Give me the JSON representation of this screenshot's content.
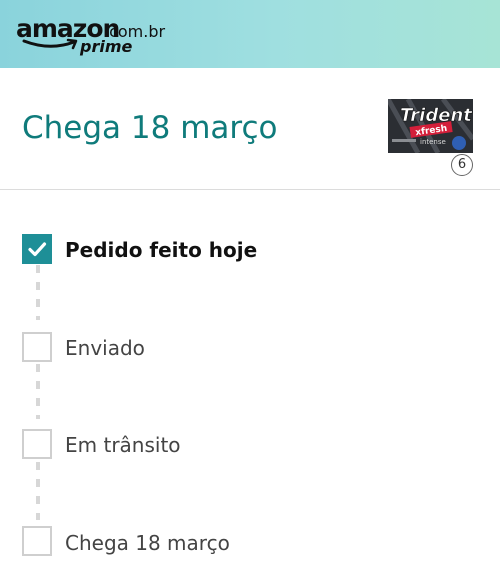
{
  "header": {
    "brand_word": "amazon",
    "brand_domain": ".com.br",
    "brand_sub": "prime"
  },
  "delivery": {
    "arrival_text": "Chega 18 março",
    "item": {
      "brand": "Trident",
      "variant": "xfresh",
      "variant2": "intense",
      "quantity": "6"
    }
  },
  "tracker": {
    "steps": [
      {
        "label": "Pedido feito hoje",
        "completed": true
      },
      {
        "label": "Enviado",
        "completed": false
      },
      {
        "label": "Em trânsito",
        "completed": false
      },
      {
        "label": "Chega 18 março",
        "completed": false
      }
    ]
  },
  "colors": {
    "accent": "#1e8f97",
    "arrival_text": "#0f7b7b",
    "header_gradient_start": "#8ad3dc",
    "header_gradient_end": "#a7e4d6"
  }
}
